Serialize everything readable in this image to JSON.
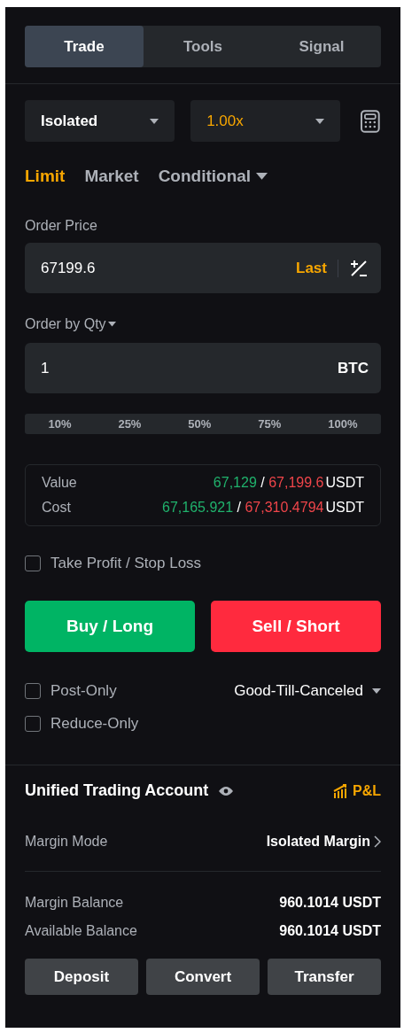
{
  "tabs": [
    {
      "label": "Trade",
      "selected": true
    },
    {
      "label": "Tools",
      "selected": false
    },
    {
      "label": "Signal",
      "selected": false
    }
  ],
  "margin_type": {
    "value": "Isolated"
  },
  "leverage": {
    "value": "1.00x"
  },
  "order_types": [
    {
      "label": "Limit",
      "selected": true,
      "kind": "plain"
    },
    {
      "label": "Market",
      "selected": false,
      "kind": "plain"
    },
    {
      "label": "Conditional",
      "selected": false,
      "kind": "dropdown"
    }
  ],
  "order_price": {
    "label": "Order Price",
    "value": "67199.6",
    "suffix": "Last"
  },
  "order_qty": {
    "label": "Order by Qty",
    "value": "1",
    "unit": "BTC"
  },
  "percent_options": [
    "10%",
    "25%",
    "50%",
    "75%",
    "100%"
  ],
  "summary": [
    {
      "label": "Value",
      "buy": "67,129",
      "separator": "/",
      "sell": "67,199.6",
      "unit": "USDT"
    },
    {
      "label": "Cost",
      "buy": "67,165.921",
      "separator": "/",
      "sell": "67,310.4794",
      "unit": "USDT"
    }
  ],
  "tp_sl": {
    "label": "Take Profit / Stop Loss",
    "checked": false
  },
  "actions": [
    {
      "label": "Buy / Long",
      "kind": "buy"
    },
    {
      "label": "Sell / Short",
      "kind": "sell"
    }
  ],
  "options": [
    {
      "label": "Post-Only",
      "checked": false
    },
    {
      "label": "Reduce-Only",
      "checked": false
    }
  ],
  "time_in_force": {
    "value": "Good-Till-Canceled"
  },
  "account": {
    "title": "Unified Trading Account",
    "pnl": "P&L",
    "margin_mode": {
      "label": "Margin Mode",
      "value": "Isolated Margin"
    },
    "balances": [
      {
        "label": "Margin Balance",
        "value": "960.1014 USDT"
      },
      {
        "label": "Available Balance",
        "value": "960.1014 USDT"
      }
    ],
    "buttons": [
      "Deposit",
      "Convert",
      "Transfer"
    ]
  }
}
